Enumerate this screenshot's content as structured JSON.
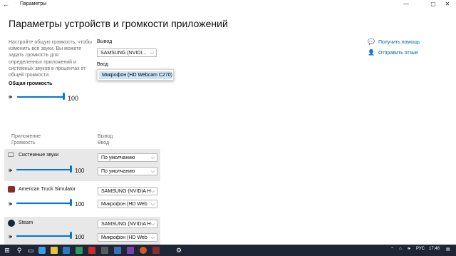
{
  "window": {
    "title": "Параметры",
    "minimize_icon": "—",
    "maximize_icon": "▢",
    "close_icon": "✕"
  },
  "page": {
    "title": "Параметры устройств и громкости приложений",
    "description": "Настройте общую громкость, чтобы изменить все звуки. Вы можете задать громкость для определенных приложений и системных звуков в процентах от общей громкости.",
    "master_volume_label": "Общая громкость",
    "master_volume_value": "100",
    "master_volume_level": 1.0
  },
  "output": {
    "label": "Вывод",
    "selected": "SAMSUNG (NVIDI..."
  },
  "input": {
    "label": "Ввод",
    "dropdown_option": "Микрофон (HD Webcam C270)"
  },
  "side_links": {
    "help": "Получить помощь",
    "feedback": "Отправить отзыв"
  },
  "apps_header": {
    "app_line1": "Приложение",
    "app_line2": "Громкость",
    "io_line1": "Вывод",
    "io_line2": "Ввод"
  },
  "apps": [
    {
      "name": "Системные звуки",
      "volume": "100",
      "level": 1.0,
      "output": "По умолчанию",
      "input": "По умолчанию",
      "highlighted": true
    },
    {
      "name": "American Truck Simulator",
      "volume": "100",
      "level": 1.0,
      "output": "SAMSUNG (NVIDIA H",
      "input": "Микрофон (HD Web",
      "highlighted": false
    },
    {
      "name": "Steam",
      "volume": "100",
      "level": 1.0,
      "output": "SAMSUNG (NVIDIA H",
      "input": "Микрофон (HD Web",
      "highlighted": true
    }
  ],
  "taskbar": {
    "lang": "РУС",
    "time": "17:46"
  },
  "colors": {
    "accent": "#0078d7",
    "taskbar": "#1f2535"
  }
}
